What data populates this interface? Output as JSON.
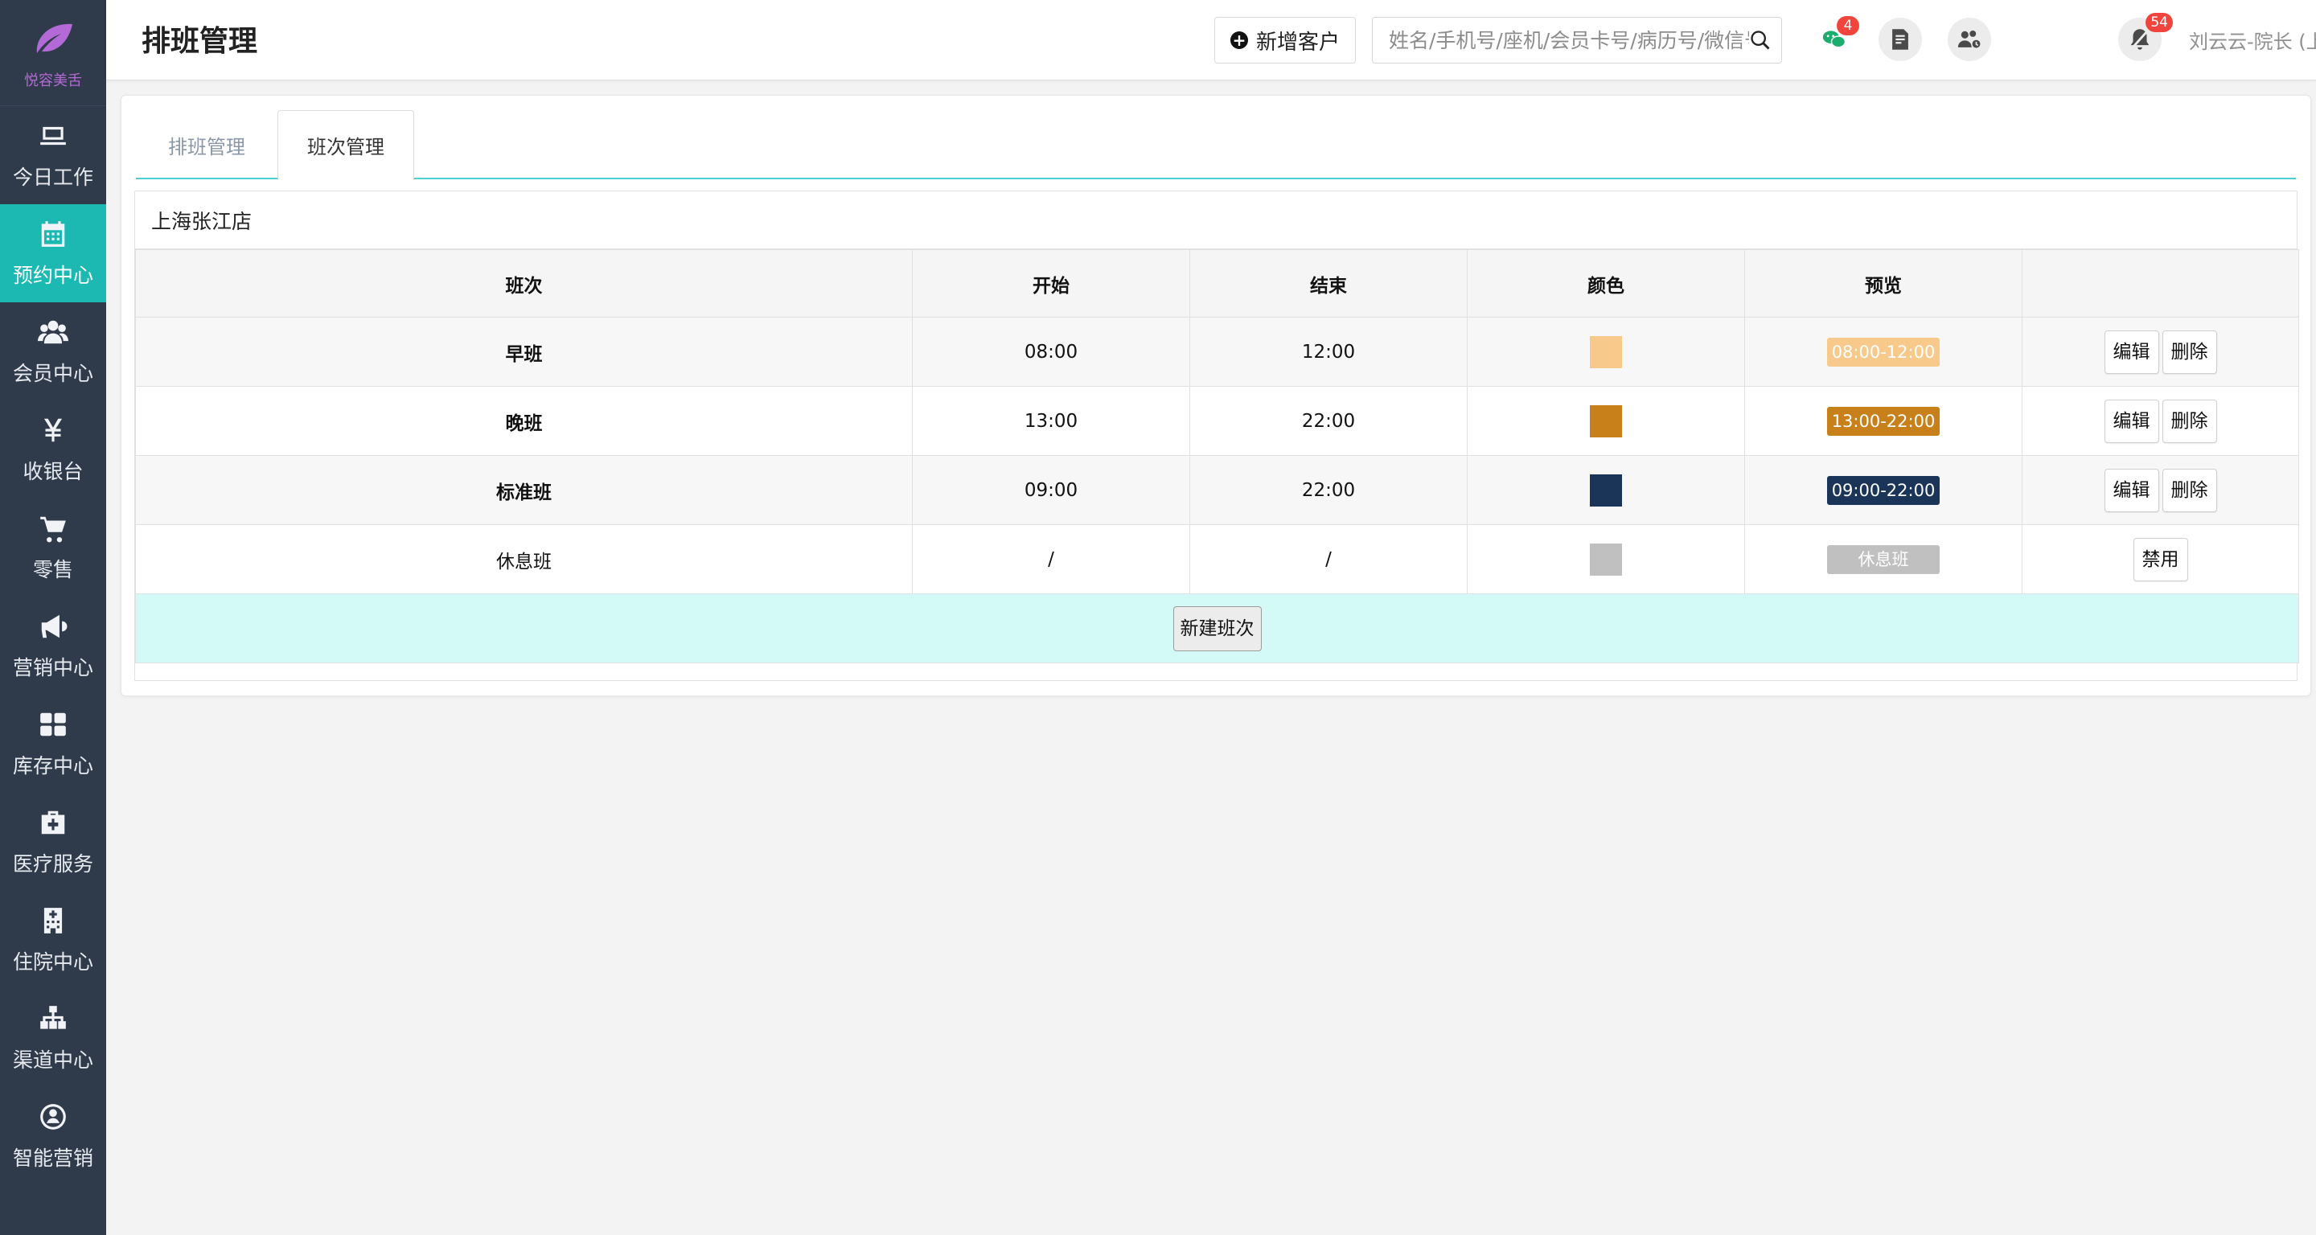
{
  "app": {
    "logo_text": "悦容美舌",
    "brand_color": "#b36ad6",
    "sidebar_bg": "#2f3a4a",
    "accent": "#1bb9b2"
  },
  "sidebar": {
    "items": [
      {
        "label": "今日工作",
        "icon": "laptop-icon"
      },
      {
        "label": "预约中心",
        "icon": "calendar-icon",
        "active": true
      },
      {
        "label": "会员中心",
        "icon": "users-icon"
      },
      {
        "label": "收银台",
        "icon": "yen-icon"
      },
      {
        "label": "零售",
        "icon": "cart-icon"
      },
      {
        "label": "营销中心",
        "icon": "megaphone-icon"
      },
      {
        "label": "库存中心",
        "icon": "grid-icon"
      },
      {
        "label": "医疗服务",
        "icon": "medkit-icon"
      },
      {
        "label": "住院中心",
        "icon": "hospital-icon"
      },
      {
        "label": "渠道中心",
        "icon": "sitemap-icon"
      },
      {
        "label": "智能营销",
        "icon": "smart-marketing-icon"
      }
    ]
  },
  "header": {
    "title": "排班管理",
    "add_customer": "新增客户",
    "search_placeholder": "姓名/手机号/座机/会员卡号/病历号/微信号",
    "wechat_badge": "4",
    "notify_badge": "54",
    "user": "刘云云-院长 (上海张江店)"
  },
  "tabs": [
    "排班管理",
    "班次管理"
  ],
  "store": "上海张江店",
  "table": {
    "headers": [
      "班次",
      "开始",
      "结束",
      "颜色",
      "预览",
      ""
    ],
    "rows": [
      {
        "name": "早班",
        "start": "08:00",
        "end": "12:00",
        "color": "#f7c98a",
        "preview": "08:00-12:00",
        "actions": [
          "编辑",
          "删除"
        ]
      },
      {
        "name": "晚班",
        "start": "13:00",
        "end": "22:00",
        "color": "#c8801a",
        "preview": "13:00-22:00",
        "actions": [
          "编辑",
          "删除"
        ]
      },
      {
        "name": "标准班",
        "start": "09:00",
        "end": "22:00",
        "color": "#1b3558",
        "preview": "09:00-22:00",
        "actions": [
          "编辑",
          "删除"
        ]
      },
      {
        "name": "休息班",
        "start": "/",
        "end": "/",
        "color": "#c0c0c0",
        "preview": "休息班",
        "actions": [
          "禁用"
        ]
      }
    ],
    "new_button": "新建班次"
  }
}
